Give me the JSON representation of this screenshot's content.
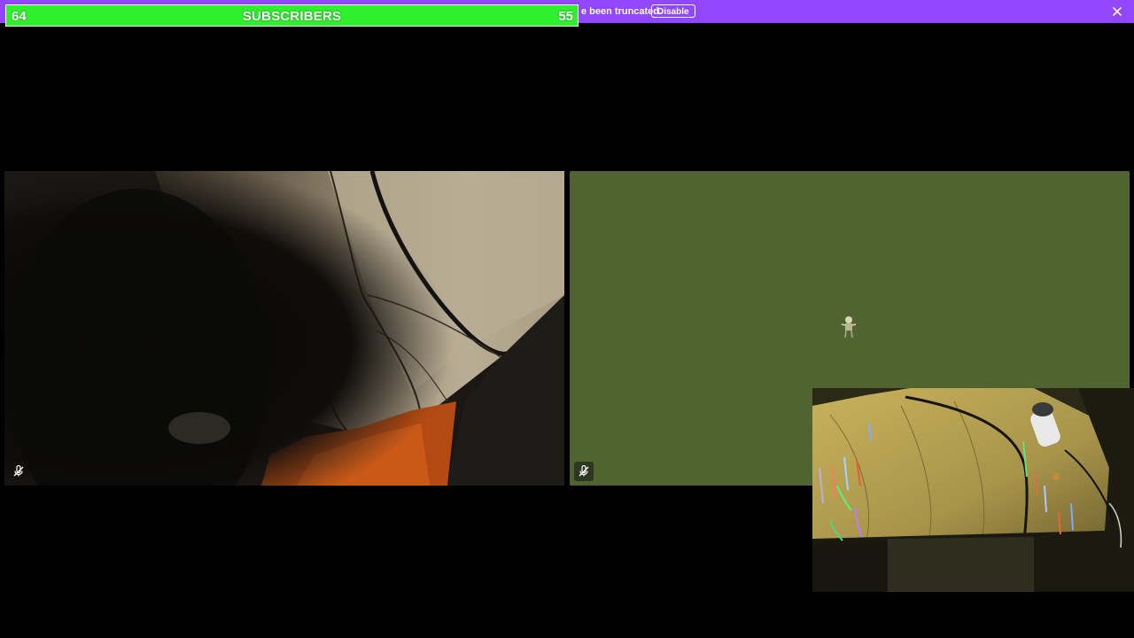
{
  "notice": {
    "text": "e been truncated.",
    "disable_label": "Disable",
    "close_icon": "close-icon",
    "color": "#9147ff"
  },
  "subscriber_goal": {
    "left_value": "64",
    "title": "SUBSCRIBERS",
    "right_value": "55",
    "color": "#2ff02c"
  },
  "tiles": {
    "left": {
      "mute_icon": "microphone-off-icon",
      "scene": "dark tent interior with orange fabric"
    },
    "right": {
      "mute_icon": "microphone-off-icon",
      "background_color": "#4f6430",
      "avatar_icon": "avatar-sprite-icon"
    }
  },
  "pip": {
    "scene": "VR tent interior with tool rack and lamp"
  }
}
